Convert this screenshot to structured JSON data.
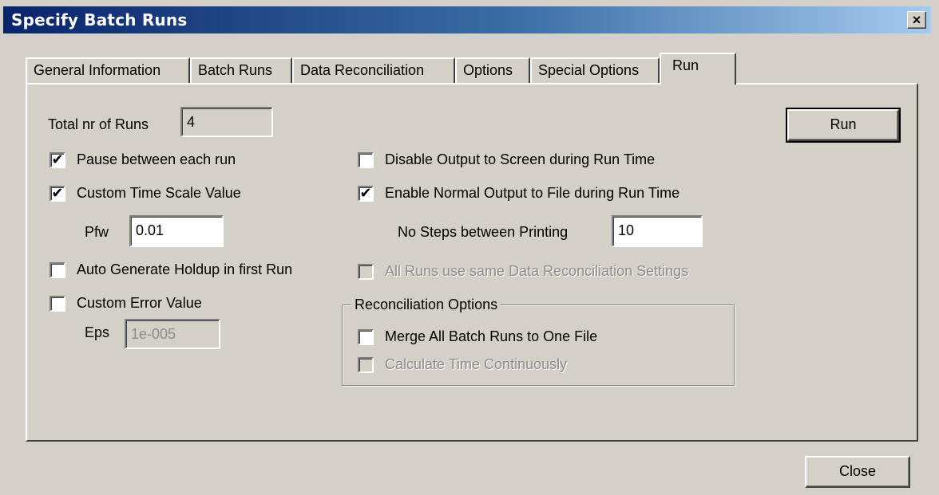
{
  "window": {
    "title": "Specify Batch Runs",
    "close_glyph": "×"
  },
  "tabs": [
    {
      "label": "General Information"
    },
    {
      "label": "Batch Runs"
    },
    {
      "label": "Data Reconciliation"
    },
    {
      "label": "Options"
    },
    {
      "label": "Special Options"
    },
    {
      "label": "Run",
      "active": true
    }
  ],
  "run": {
    "total_runs_label": "Total nr of Runs",
    "total_runs_value": "4",
    "run_button": "Run",
    "pause": {
      "label": "Pause between each run",
      "checked": true
    },
    "custom_time": {
      "label": "Custom Time Scale Value",
      "checked": true
    },
    "pfw_label": "Pfw",
    "pfw_value": "0.01",
    "auto_holdup": {
      "label": "Auto Generate Holdup in first Run",
      "checked": false
    },
    "custom_error": {
      "label": "Custom Error Value",
      "checked": false
    },
    "eps_label": "Eps",
    "eps_value": "1e-005",
    "disable_output": {
      "label": "Disable Output to Screen during Run Time",
      "checked": false
    },
    "enable_output": {
      "label": "Enable Normal Output to File during Run Time",
      "checked": true
    },
    "steps_label": "No Steps between Printing",
    "steps_value": "10",
    "same_settings": {
      "label": "All Runs use same Data Reconciliation Settings",
      "checked": false,
      "disabled": true
    },
    "reconciliation": {
      "title": "Reconciliation Options",
      "merge": {
        "label": "Merge All Batch Runs to One File",
        "checked": false
      },
      "continuous": {
        "label": "Calculate Time Continuously",
        "checked": false,
        "disabled": true
      }
    }
  },
  "footer": {
    "close_button": "Close"
  },
  "check_glyph": "✔"
}
